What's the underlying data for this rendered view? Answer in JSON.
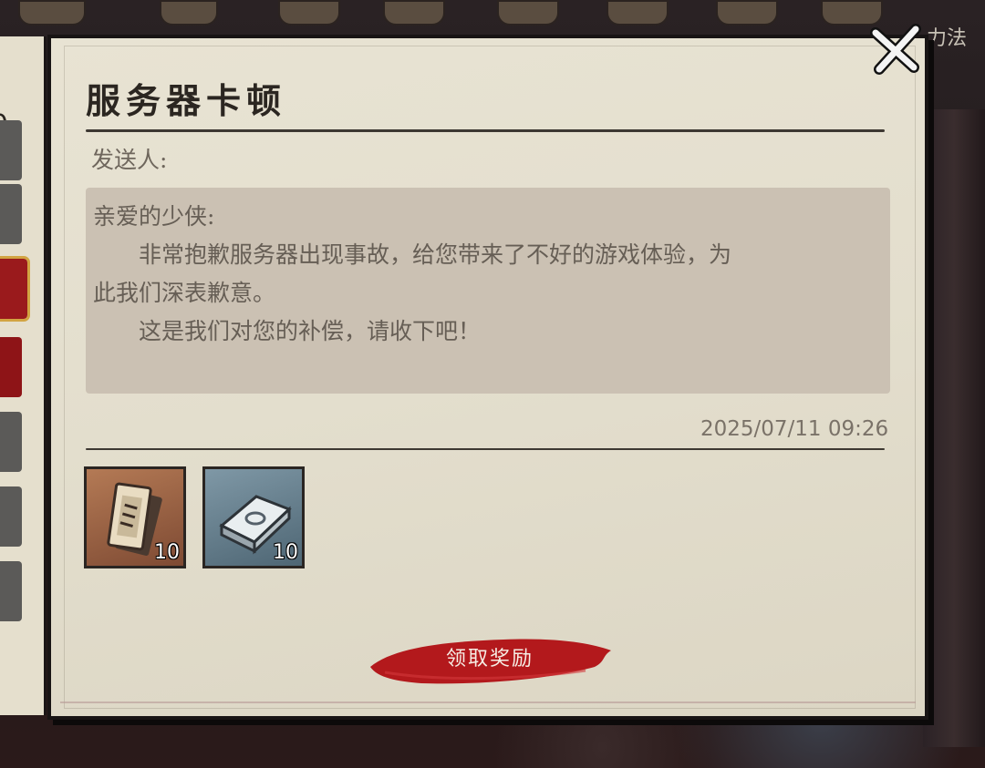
{
  "top_bar": {
    "side_tab_text": "力法"
  },
  "mail_list": {
    "count_text": "0"
  },
  "mail": {
    "title": "服务器卡顿",
    "sender_label": "发送人:",
    "greeting": "亲爱的少侠:",
    "body_line1": "非常抱歉服务器出现事故，给您带来了不好的游戏体验，为",
    "body_line2": "此我们深表歉意。",
    "body_line3": "这是我们对您的补偿，请收下吧！",
    "date": "2025/07/11 09:26"
  },
  "rewards": [
    {
      "name": "scroll-ticket-item",
      "icon": "scroll-icon",
      "qty": "10",
      "color": "#b47a55"
    },
    {
      "name": "silver-ingot-item",
      "icon": "silver-ingot-icon",
      "qty": "10",
      "color": "#7f98a6"
    }
  ],
  "actions": {
    "claim_label": "领取奖励",
    "close_icon": "close-x-icon"
  },
  "colors": {
    "accent_red": "#b3191c",
    "paper": "#e5e0d0",
    "message_box": "#cbc1b3"
  }
}
